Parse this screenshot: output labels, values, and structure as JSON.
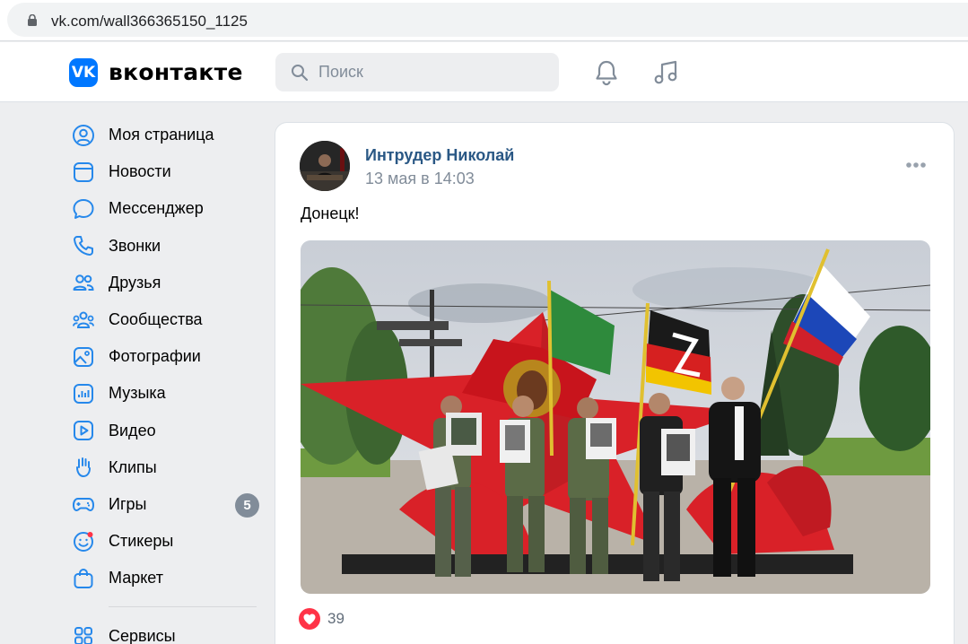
{
  "browser": {
    "url": "vk.com/wall366365150_1125"
  },
  "header": {
    "brand": "вконтакте",
    "logo_text": "VK",
    "search_placeholder": "Поиск"
  },
  "sidebar": {
    "items": [
      {
        "label": "Моя страница",
        "icon": "user-circle-icon"
      },
      {
        "label": "Новости",
        "icon": "news-icon"
      },
      {
        "label": "Мессенджер",
        "icon": "message-icon"
      },
      {
        "label": "Звонки",
        "icon": "phone-icon"
      },
      {
        "label": "Друзья",
        "icon": "friends-icon"
      },
      {
        "label": "Сообщества",
        "icon": "communities-icon"
      },
      {
        "label": "Фотографии",
        "icon": "photo-icon"
      },
      {
        "label": "Музыка",
        "icon": "music-icon"
      },
      {
        "label": "Видео",
        "icon": "video-icon"
      },
      {
        "label": "Клипы",
        "icon": "clips-icon"
      },
      {
        "label": "Игры",
        "icon": "games-icon",
        "badge": "5"
      },
      {
        "label": "Стикеры",
        "icon": "stickers-icon"
      },
      {
        "label": "Маркет",
        "icon": "market-icon"
      }
    ],
    "services_label": "Сервисы"
  },
  "post": {
    "author": "Интрудер Николай",
    "date": "13 мая в 14:03",
    "text": "Донецк!",
    "likes": "39"
  },
  "colors": {
    "accent": "#0077ff",
    "link": "#2a5885",
    "muted": "#818c99",
    "like": "#ff3347",
    "bg": "#edeef0"
  }
}
